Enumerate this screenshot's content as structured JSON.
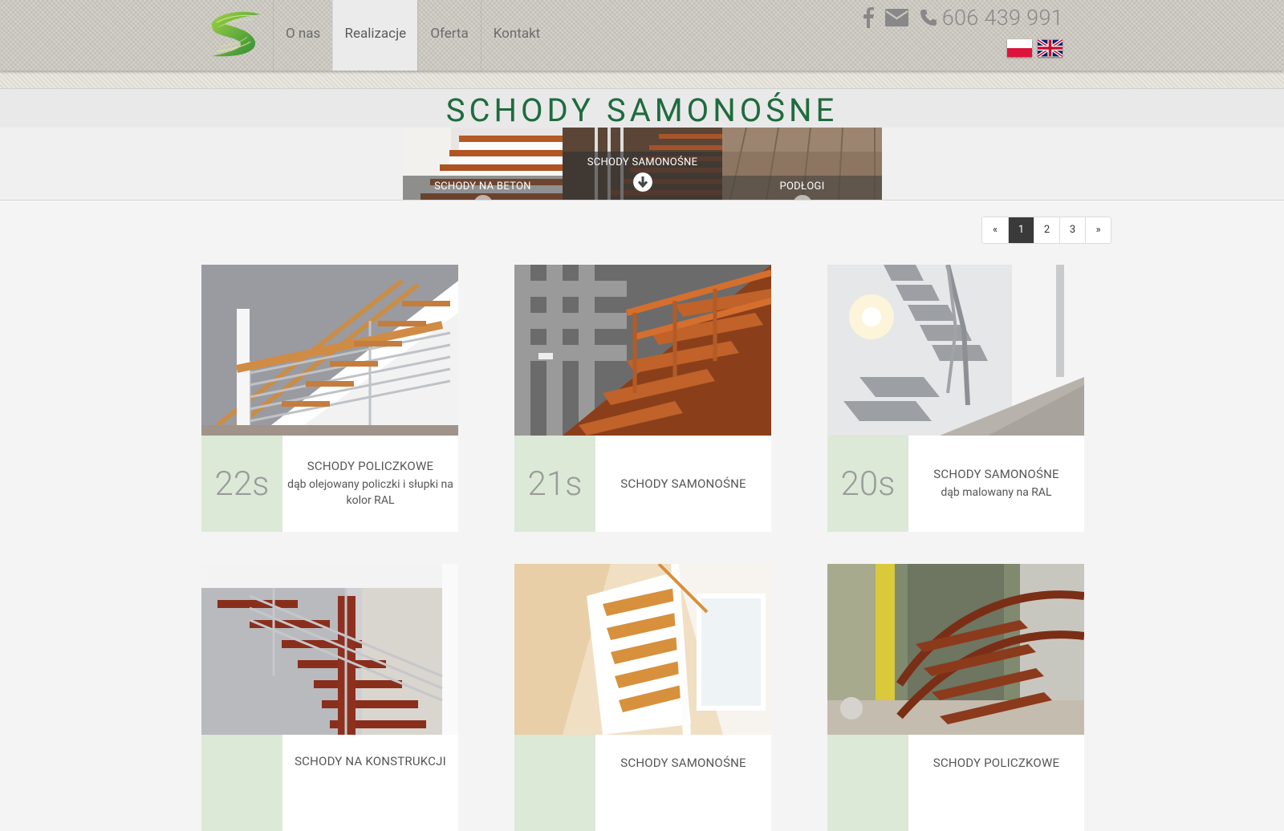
{
  "header": {
    "nav": [
      "O nas",
      "Realizacje",
      "Oferta",
      "Kontakt"
    ],
    "phone": "606 439 991",
    "icons": [
      "facebook-icon",
      "envelope-icon",
      "phone-icon"
    ],
    "languages": [
      "pl",
      "en"
    ]
  },
  "page": {
    "title": "SCHODY SAMONOŚNE"
  },
  "categories": [
    {
      "label": "SCHODY NA BETON",
      "active": false
    },
    {
      "label": "SCHODY SAMONOŚNE",
      "active": true
    },
    {
      "label": "PODŁOGI",
      "active": false
    }
  ],
  "pagination": {
    "prev": "«",
    "pages": [
      "1",
      "2",
      "3"
    ],
    "current": "1",
    "next": "»"
  },
  "cards": [
    {
      "num": "22s",
      "title": "SCHODY POLICZKOWE",
      "desc": "dąb olejowany policzki i słupki na kolor RAL"
    },
    {
      "num": "21s",
      "title": "SCHODY SAMONOŚNE",
      "desc": ""
    },
    {
      "num": "20s",
      "title": "SCHODY SAMONOŚNE",
      "desc": "dąb malowany na RAL"
    },
    {
      "num": "",
      "title": "SCHODY NA KONSTRUKCJI",
      "desc": ""
    },
    {
      "num": "",
      "title": "SCHODY SAMONOŚNE",
      "desc": ""
    },
    {
      "num": "",
      "title": "SCHODY POLICZKOWE",
      "desc": ""
    }
  ],
  "colors": {
    "title_green": "#1f6b3e",
    "number_panel": "#dbe9d6",
    "header_bg": "#ccc9c1",
    "active_page": "#3a3a3a"
  }
}
